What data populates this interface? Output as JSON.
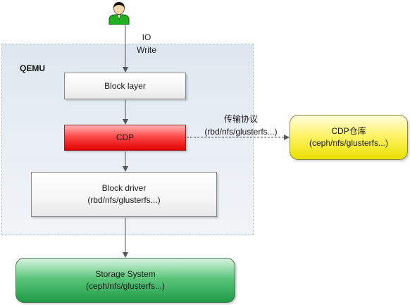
{
  "qemu": {
    "label": "QEMU"
  },
  "io_label": {
    "line1": "IO",
    "line2": "Write"
  },
  "block_layer": {
    "label": "Block layer"
  },
  "cdp": {
    "label": "CDP"
  },
  "block_driver": {
    "line1": "Block driver",
    "line2": "(rbd/nfs/glusterfs...)"
  },
  "protocol": {
    "line1": "传输协议",
    "line2": "(rbd/nfs/glusterfs...)"
  },
  "cdp_repo": {
    "line1": "CDP仓库",
    "line2": "(ceph/nfs/glusterfs...)"
  },
  "storage": {
    "line1": "Storage System",
    "line2": "(ceph/nfs/glusterfs...)"
  },
  "colors": {
    "cdp": "#ff4a4a",
    "cdp_repo": "#fff36a",
    "storage": "#5cc77c",
    "user_shirt": "#22b022"
  },
  "icons": {
    "user": "user-icon"
  }
}
